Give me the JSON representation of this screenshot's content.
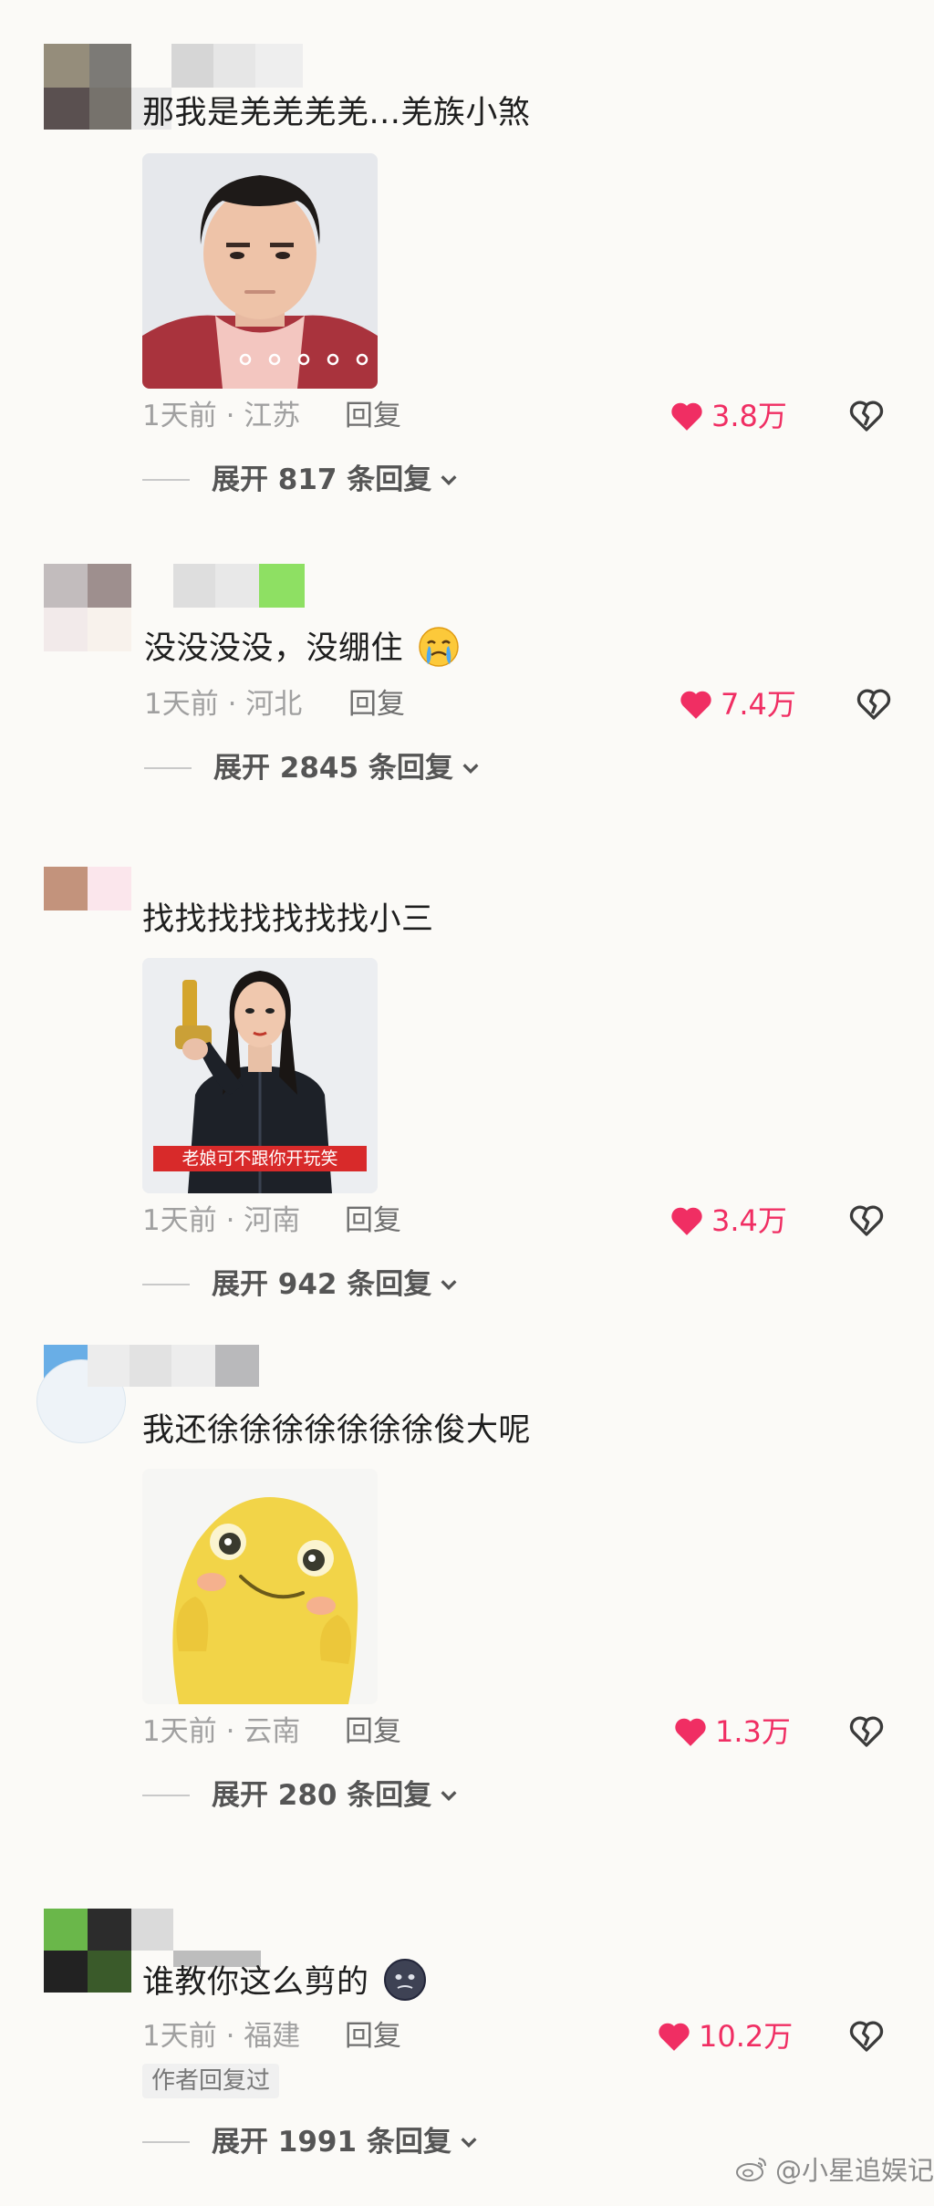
{
  "comments": [
    {
      "text": "那我是羌羌羌羌...羌族小煞",
      "time_location": "1天前 · 江苏",
      "reply_label": "回复",
      "likes": "3.8万",
      "expand_label": "展开 817 条回复"
    },
    {
      "text": "没没没没，没绷住",
      "time_location": "1天前 · 河北",
      "reply_label": "回复",
      "likes": "7.4万",
      "expand_label": "展开 2845 条回复"
    },
    {
      "text": "找找找找找找找小三",
      "image_caption": "老娘可不跟你开玩笑",
      "time_location": "1天前 · 河南",
      "reply_label": "回复",
      "likes": "3.4万",
      "expand_label": "展开 942 条回复"
    },
    {
      "text": "我还徐徐徐徐徐徐徐俊大呢",
      "time_location": "1天前 · 云南",
      "reply_label": "回复",
      "likes": "1.3万",
      "expand_label": "展开 280 条回复"
    },
    {
      "text": "谁教你这么剪的",
      "time_location": "1天前 · 福建",
      "reply_label": "回复",
      "likes": "10.2万",
      "author_badge": "作者回复过",
      "expand_label": "展开 1991 条回复"
    }
  ],
  "watermark": "@小星追娱记",
  "colors": {
    "like": "#f02e63",
    "meta": "#a0a0a0",
    "background": "#fbfaf7"
  },
  "icons": [
    "heart-icon",
    "broken-heart-icon",
    "chevron-down-icon",
    "weibo-icon",
    "crying-emoji-icon",
    "dark-face-emoji-icon"
  ]
}
